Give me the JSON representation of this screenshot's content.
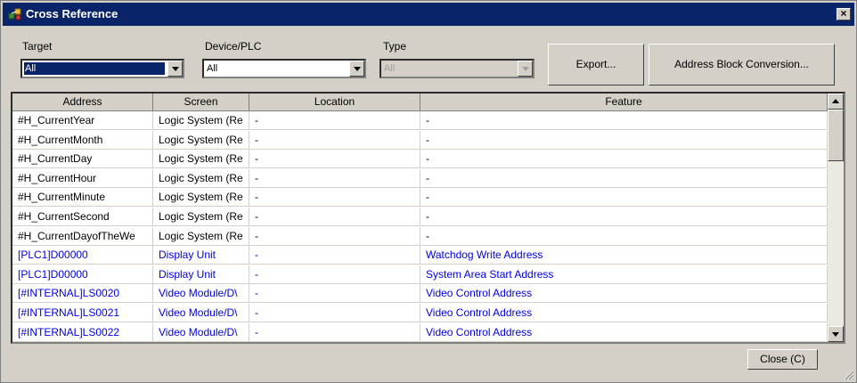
{
  "window": {
    "title": "Cross Reference",
    "close_glyph": "×",
    "icon": "cross-reference-icon"
  },
  "filters": {
    "target": {
      "label": "Target",
      "value": "All"
    },
    "device": {
      "label": "Device/PLC",
      "value": "All"
    },
    "type": {
      "label": "Type",
      "value": "All",
      "disabled": true
    }
  },
  "buttons": {
    "export": "Export...",
    "address_block": "Address Block Conversion...",
    "close": "Close (C)"
  },
  "table": {
    "columns": [
      "Address",
      "Screen",
      "Location",
      "Feature"
    ],
    "rows": [
      {
        "address": "#H_CurrentYear",
        "screen": "Logic System (Re",
        "location": "-",
        "feature": "-",
        "link": false
      },
      {
        "address": "#H_CurrentMonth",
        "screen": "Logic System (Re",
        "location": "-",
        "feature": "-",
        "link": false
      },
      {
        "address": "#H_CurrentDay",
        "screen": "Logic System (Re",
        "location": "-",
        "feature": "-",
        "link": false
      },
      {
        "address": "#H_CurrentHour",
        "screen": "Logic System (Re",
        "location": "-",
        "feature": "-",
        "link": false
      },
      {
        "address": "#H_CurrentMinute",
        "screen": "Logic System (Re",
        "location": "-",
        "feature": "-",
        "link": false
      },
      {
        "address": "#H_CurrentSecond",
        "screen": "Logic System (Re",
        "location": "-",
        "feature": "-",
        "link": false
      },
      {
        "address": "#H_CurrentDayofTheWe",
        "screen": "Logic System (Re",
        "location": "-",
        "feature": "-",
        "link": false
      },
      {
        "address": "[PLC1]D00000",
        "screen": "Display Unit",
        "location": "-",
        "feature": "Watchdog Write Address",
        "link": true
      },
      {
        "address": "[PLC1]D00000",
        "screen": "Display Unit",
        "location": "-",
        "feature": "System Area Start Address",
        "link": true
      },
      {
        "address": "[#INTERNAL]LS0020",
        "screen": "Video Module/D\\",
        "location": "-",
        "feature": "Video Control Address",
        "link": true
      },
      {
        "address": "[#INTERNAL]LS0021",
        "screen": "Video Module/D\\",
        "location": "-",
        "feature": "Video Control Address",
        "link": true
      },
      {
        "address": "[#INTERNAL]LS0022",
        "screen": "Video Module/D\\",
        "location": "-",
        "feature": "Video Control Address",
        "link": true
      }
    ]
  },
  "colors": {
    "titlebar": "#0a246a",
    "link_text": "#0000e0",
    "dialog_bg": "#d4d0c8"
  }
}
